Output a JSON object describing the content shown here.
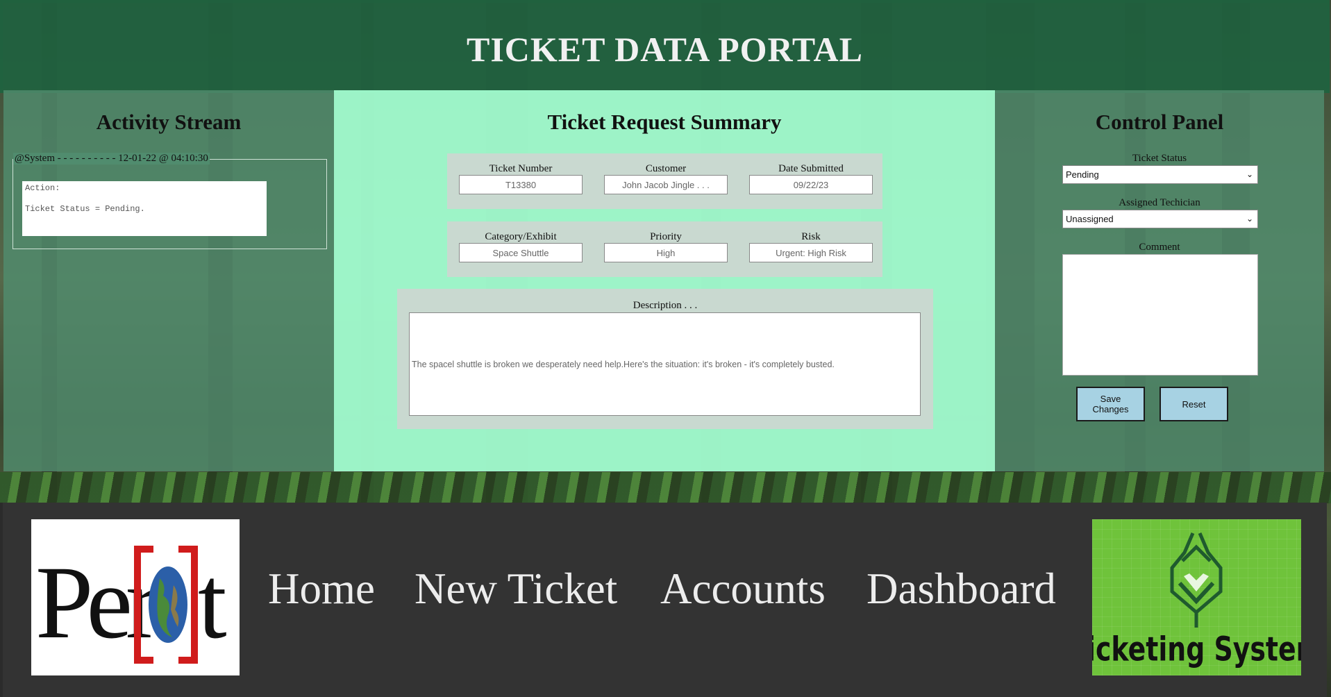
{
  "header": {
    "title": "TICKET DATA PORTAL"
  },
  "activity": {
    "title": "Activity Stream",
    "entry_header": "@System - - - - - - - - - - 12-01-22 @ 04:10:30",
    "action_label": "Action:",
    "action_text": "Ticket Status = Pending."
  },
  "summary": {
    "title": "Ticket Request Summary",
    "ticket_number": {
      "label": "Ticket Number",
      "value": "T13380"
    },
    "customer": {
      "label": "Customer",
      "value": "John Jacob Jingle . . ."
    },
    "date_submitted": {
      "label": "Date Submitted",
      "value": "09/22/23"
    },
    "category": {
      "label": "Category/Exhibit",
      "value": "Space Shuttle"
    },
    "priority": {
      "label": "Priority",
      "value": "High"
    },
    "risk": {
      "label": "Risk",
      "value": "Urgent: High Risk"
    },
    "description": {
      "label": "Description . . .",
      "value": "The spacel shuttle is broken we desperately need help.Here's the situation: it's broken - it's completely busted."
    }
  },
  "control": {
    "title": "Control Panel",
    "status_label": "Ticket Status",
    "status_value": "Pending",
    "tech_label": "Assigned Techician",
    "tech_value": "Unassigned",
    "comment_label": "Comment",
    "save_label": "Save Changes",
    "reset_label": "Reset"
  },
  "footer": {
    "logo_left_text": "Per[o]t",
    "logo_right_text": "Ticketing System",
    "nav": [
      "Home",
      "New Ticket",
      "Accounts",
      "Dashboard"
    ]
  },
  "colors": {
    "header_bg": "#206240",
    "side_panel_bg": "#508c6e",
    "summary_bg": "#a0facd",
    "button_bg": "#a7d2e3",
    "footer_bg": "#333333",
    "logo_bracket_red": "#d01c1c",
    "logo_right_bg": "#6fc33b"
  }
}
